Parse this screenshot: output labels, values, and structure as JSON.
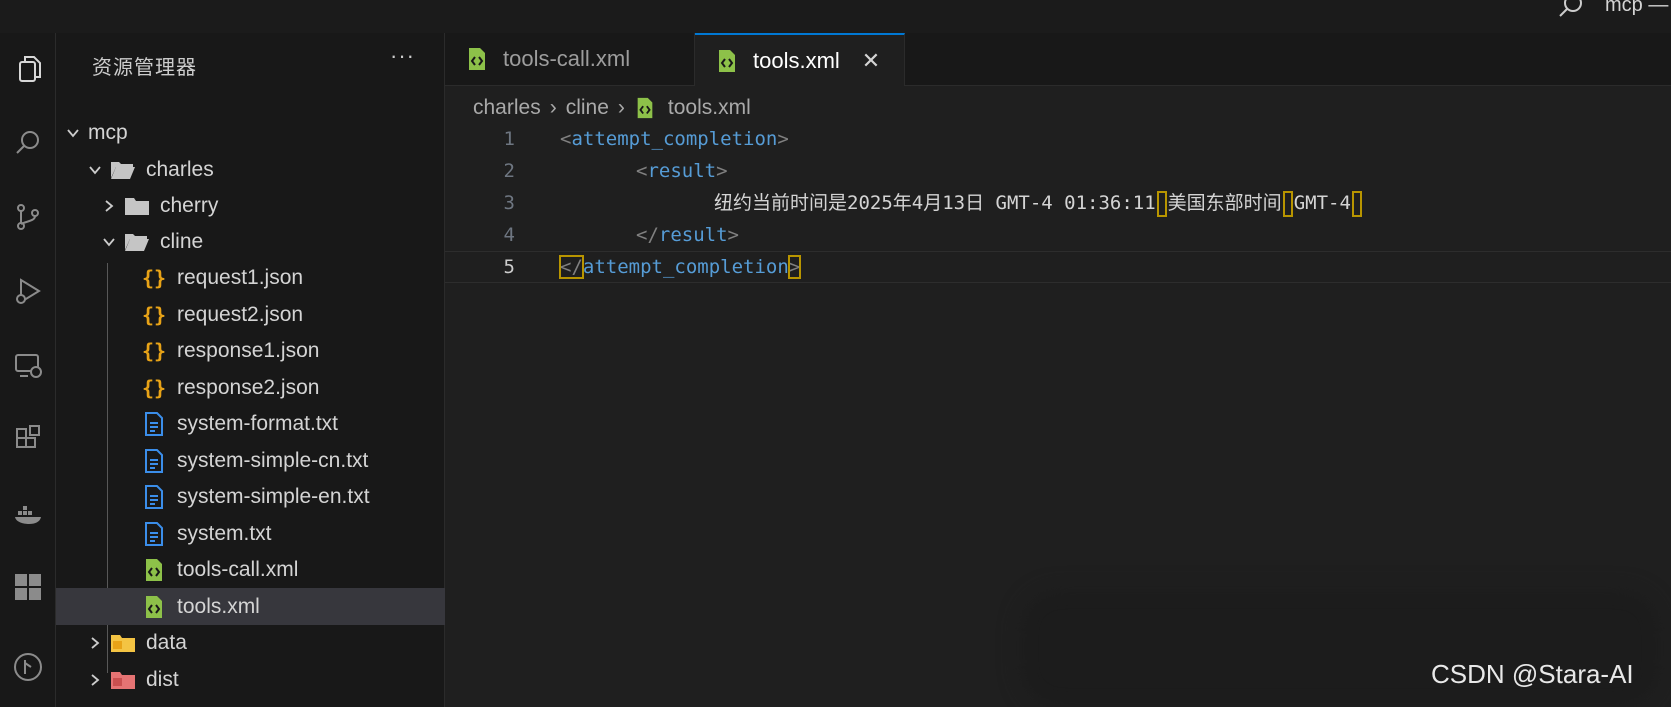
{
  "titlebar": {
    "title": "mcp —"
  },
  "activity_bar": {
    "items": [
      "explorer-icon",
      "search-icon",
      "source-control-icon",
      "run-debug-icon",
      "remote-explorer-icon",
      "extensions-icon",
      "docker-icon",
      "grid-icon",
      "git-graph-icon"
    ]
  },
  "sidebar": {
    "header": "资源管理器",
    "more": "···",
    "tree": [
      {
        "label": "mcp",
        "type": "folder-root",
        "expanded": true
      },
      {
        "label": "charles",
        "type": "folder",
        "expanded": true
      },
      {
        "label": "cherry",
        "type": "folder",
        "expanded": false
      },
      {
        "label": "cline",
        "type": "folder",
        "expanded": true
      },
      {
        "label": "request1.json",
        "type": "json"
      },
      {
        "label": "request2.json",
        "type": "json"
      },
      {
        "label": "response1.json",
        "type": "json"
      },
      {
        "label": "response2.json",
        "type": "json"
      },
      {
        "label": "system-format.txt",
        "type": "txt"
      },
      {
        "label": "system-simple-cn.txt",
        "type": "txt"
      },
      {
        "label": "system-simple-en.txt",
        "type": "txt"
      },
      {
        "label": "system.txt",
        "type": "txt"
      },
      {
        "label": "tools-call.xml",
        "type": "xml"
      },
      {
        "label": "tools.xml",
        "type": "xml",
        "selected": true
      },
      {
        "label": "data",
        "type": "folder-data",
        "expanded": false
      },
      {
        "label": "dist",
        "type": "folder-dist",
        "expanded": false
      }
    ]
  },
  "tabs": [
    {
      "label": "tools-call.xml",
      "active": false
    },
    {
      "label": "tools.xml",
      "active": true,
      "close": "✕"
    }
  ],
  "breadcrumb": [
    "charles",
    "cline",
    "tools.xml"
  ],
  "editor": {
    "lines": [
      {
        "num": "1",
        "open": "<",
        "tag": "attempt_completion",
        "close": ">"
      },
      {
        "num": "2",
        "open": "<",
        "tag": "result",
        "close": ">"
      },
      {
        "num": "3",
        "text_a": "纽约当前时间是2025年4月13日 GMT-4 01:36:11",
        "text_b": "美国东部时间",
        "text_c": "GMT-4"
      },
      {
        "num": "4",
        "open": "</",
        "tag": "result",
        "close": ">"
      },
      {
        "num": "5",
        "open": "</",
        "tag": "attempt_completion",
        "close": ">"
      }
    ]
  },
  "watermark": "CSDN @Stara-AI",
  "colors": {
    "accent": "#0078d4",
    "tag": "#569cd6",
    "bracket_highlight": "#b89500",
    "json_icon": "#e8a317",
    "txt_icon": "#3b8eea",
    "xml_icon": "#8dc149"
  }
}
